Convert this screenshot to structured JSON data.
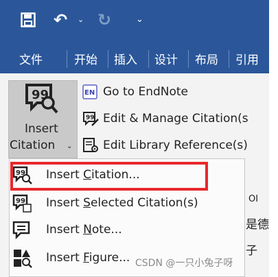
{
  "qat": {
    "save_icon": "save-icon",
    "undo_icon": "undo-icon",
    "redo_icon": "redo-icon",
    "more_icon": "customize-quick-access-icon"
  },
  "tabs": [
    "文件",
    "开始",
    "插入",
    "设计",
    "布局",
    "引用"
  ],
  "insert_citation": {
    "label_line1": "Insert",
    "label_line2": "Citation",
    "drop_symbol": "⌄",
    "icon": "insert-citation-icon"
  },
  "ribbon_buttons": [
    {
      "label": "Go to EndNote",
      "icon": "endnote-icon"
    },
    {
      "label": "Edit & Manage Citation(s",
      "icon": "edit-citation-icon"
    },
    {
      "label": "Edit Library Reference(s)",
      "icon": "edit-library-reference-icon"
    }
  ],
  "menu_items": [
    {
      "label": "Insert Citation...",
      "mnemonic": "C",
      "icon": "insert-citation-icon"
    },
    {
      "label": "Insert Selected Citation(s)",
      "mnemonic": "S",
      "icon": "insert-selected-citation-icon"
    },
    {
      "label": "Insert Note...",
      "mnemonic": "N",
      "icon": "insert-note-icon"
    },
    {
      "label": "Insert Figure...",
      "mnemonic": "F",
      "icon": "insert-figure-icon"
    }
  ],
  "background_text": {
    "label_a": "OI",
    "label_b": "是德",
    "label_c": "子"
  },
  "watermark": "CSDN @一只小兔子呀",
  "colors": {
    "title_bar": "#2b579a",
    "highlight_border": "#e8282c",
    "ribbon_bg": "#f3f3f3"
  }
}
